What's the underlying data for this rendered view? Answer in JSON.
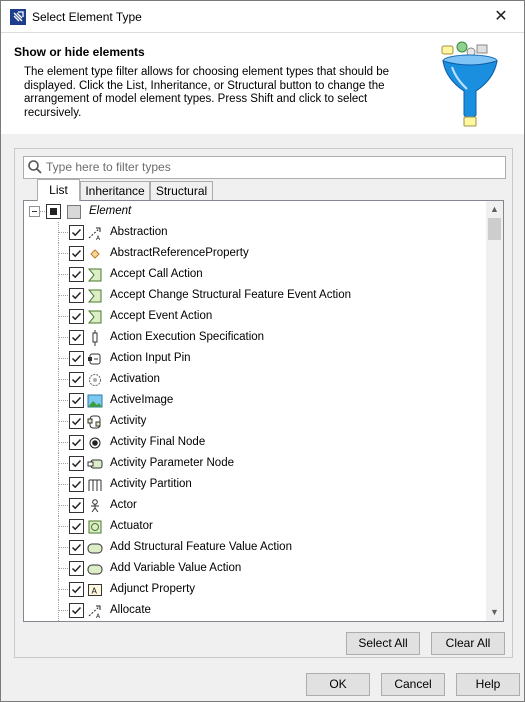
{
  "window": {
    "title": "Select Element Type",
    "close_glyph": "✕"
  },
  "header": {
    "title": "Show or hide elements",
    "description": "The element type filter allows for choosing element types that should be displayed. Click the List, Inheritance, or Structural button to change the arrangement of model element types. Press Shift and click to select recursively."
  },
  "search": {
    "placeholder": "Type here to filter types",
    "value": ""
  },
  "tabs": [
    {
      "label": "List",
      "active": true
    },
    {
      "label": "Inheritance",
      "active": false
    },
    {
      "label": "Structural",
      "active": false
    }
  ],
  "tree": {
    "root": {
      "label": "Element",
      "checked": "partial"
    },
    "items": [
      {
        "label": "Abstraction",
        "checked": true,
        "icon": "abstraction-icon"
      },
      {
        "label": "AbstractReferenceProperty",
        "checked": true,
        "icon": "reference-property-icon"
      },
      {
        "label": "Accept Call Action",
        "checked": true,
        "icon": "accept-action-icon"
      },
      {
        "label": "Accept Change Structural Feature Event Action",
        "checked": true,
        "icon": "accept-action-icon"
      },
      {
        "label": "Accept Event Action",
        "checked": true,
        "icon": "accept-action-icon"
      },
      {
        "label": "Action Execution Specification",
        "checked": true,
        "icon": "execution-spec-icon"
      },
      {
        "label": "Action Input Pin",
        "checked": true,
        "icon": "input-pin-icon"
      },
      {
        "label": "Activation",
        "checked": true,
        "icon": "activation-icon"
      },
      {
        "label": "ActiveImage",
        "checked": true,
        "icon": "image-icon"
      },
      {
        "label": "Activity",
        "checked": true,
        "icon": "activity-icon"
      },
      {
        "label": "Activity Final Node",
        "checked": true,
        "icon": "final-node-icon"
      },
      {
        "label": "Activity Parameter Node",
        "checked": true,
        "icon": "parameter-node-icon"
      },
      {
        "label": "Activity Partition",
        "checked": true,
        "icon": "partition-icon"
      },
      {
        "label": "Actor",
        "checked": true,
        "icon": "actor-icon"
      },
      {
        "label": "Actuator",
        "checked": true,
        "icon": "actuator-icon"
      },
      {
        "label": "Add Structural Feature Value Action",
        "checked": true,
        "icon": "action-icon"
      },
      {
        "label": "Add Variable Value Action",
        "checked": true,
        "icon": "action-icon"
      },
      {
        "label": "Adjunct Property",
        "checked": true,
        "icon": "adjunct-property-icon"
      },
      {
        "label": "Allocate",
        "checked": true,
        "icon": "allocate-icon"
      }
    ]
  },
  "buttons": {
    "select_all": "Select All",
    "clear_all": "Clear All",
    "ok": "OK",
    "cancel": "Cancel",
    "help": "Help"
  },
  "colors": {
    "accent": "#0078d7",
    "funnel_blue": "#1a8fe0"
  }
}
